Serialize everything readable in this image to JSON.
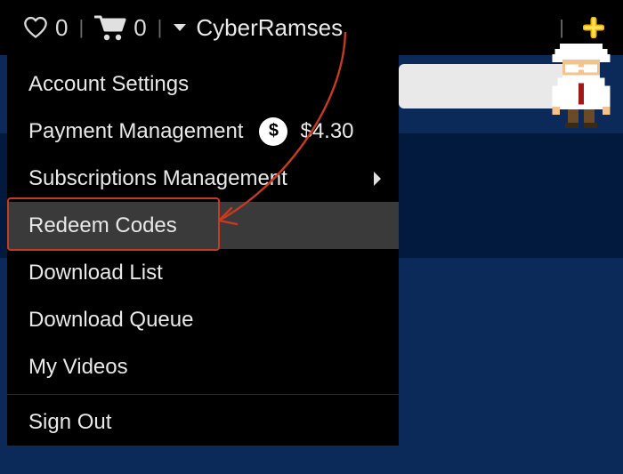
{
  "header": {
    "wishlist_count": "0",
    "cart_count": "0",
    "username": "CyberRamses"
  },
  "menu": {
    "account_settings": "Account Settings",
    "payment_management": "Payment Management",
    "balance": "$4.30",
    "subscriptions": "Subscriptions Management",
    "redeem_codes": "Redeem Codes",
    "download_list": "Download List",
    "download_queue": "Download Queue",
    "my_videos": "My Videos",
    "sign_out": "Sign Out"
  }
}
